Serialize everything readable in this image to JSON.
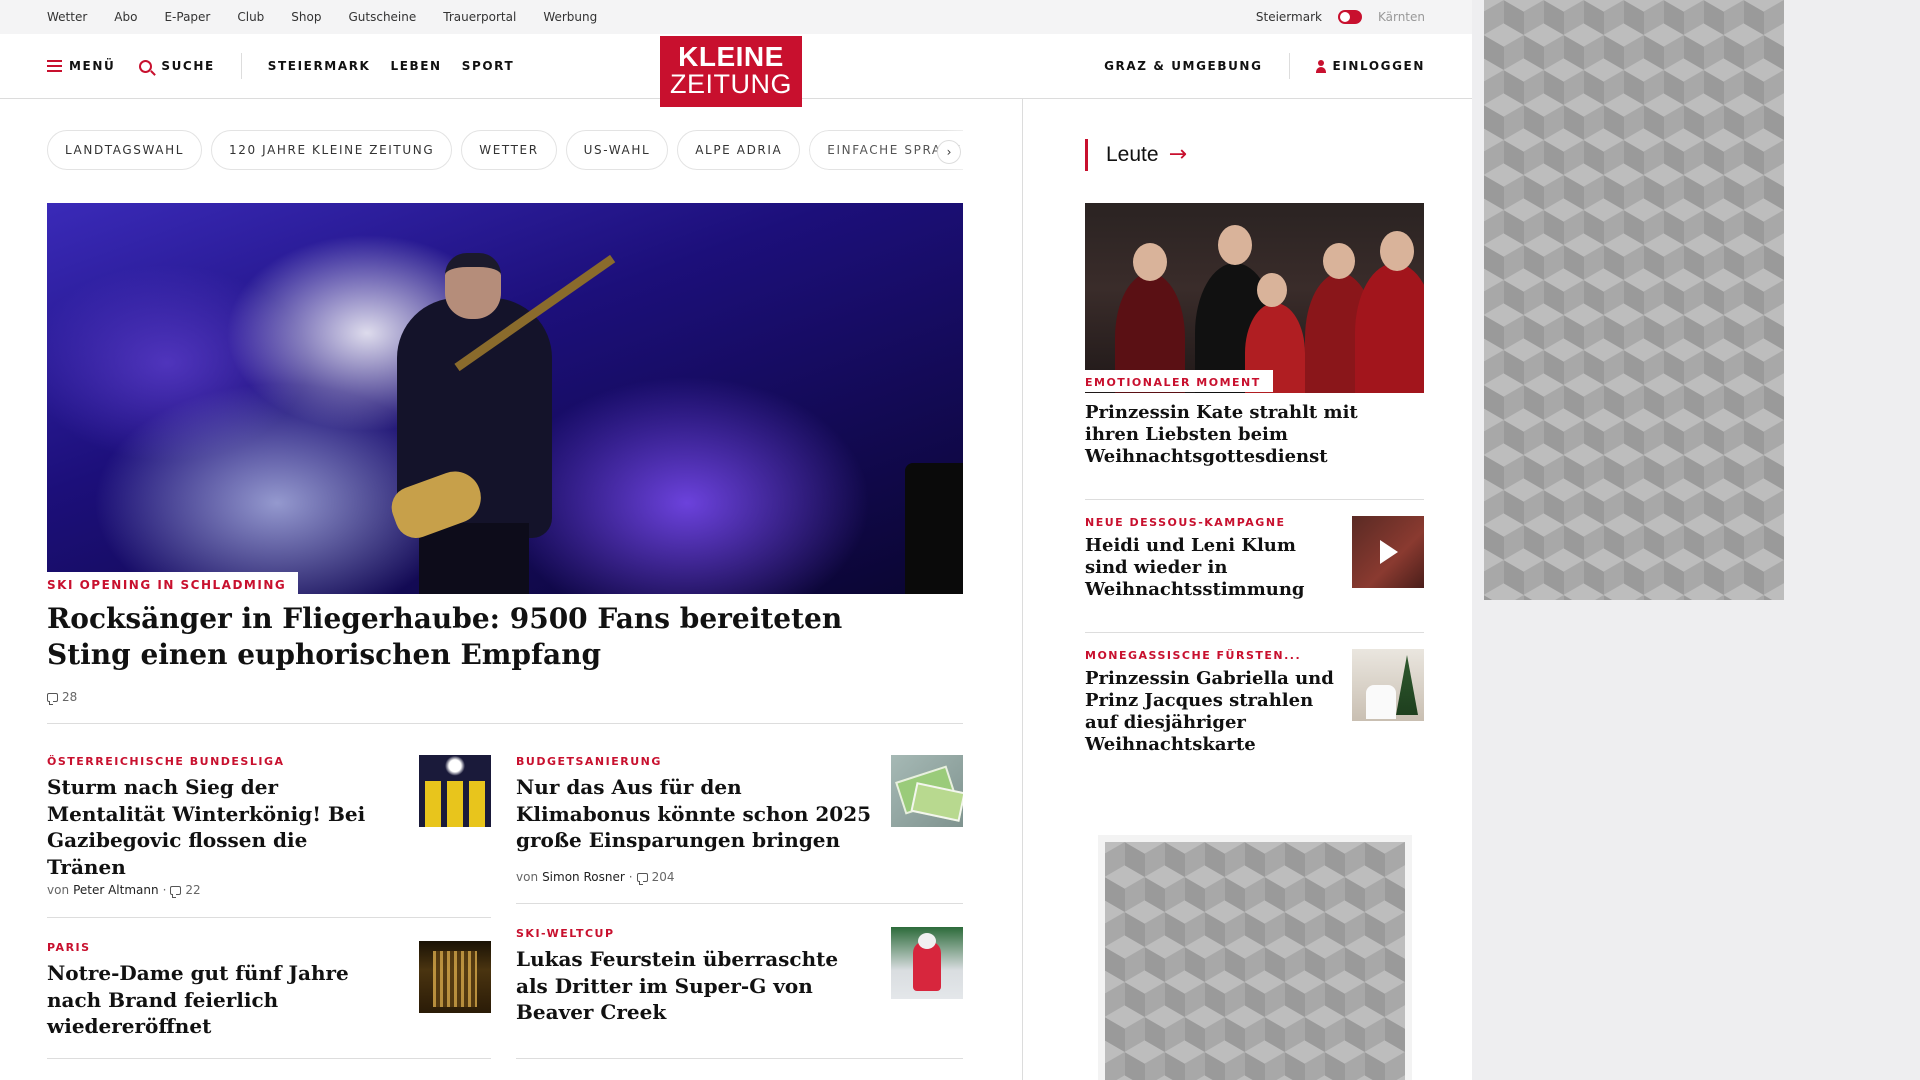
{
  "topbar": {
    "links": [
      "Wetter",
      "Abo",
      "E-Paper",
      "Club",
      "Shop",
      "Gutscheine",
      "Trauerportal",
      "Werbung"
    ],
    "region_left": "Steiermark",
    "region_right": "Kärnten"
  },
  "header": {
    "menu_label": "MENÜ",
    "search_label": "SUCHE",
    "nav": [
      "STEIERMARK",
      "LEBEN",
      "SPORT"
    ],
    "logo_line1": "KLEINE",
    "logo_line2": "ZEITUNG",
    "region_link": "GRAZ & UMGEBUNG",
    "login_label": "EINLOGGEN",
    "brand_color": "#c8102e"
  },
  "pills": [
    "LANDTAGSWAHL",
    "120 JAHRE KLEINE ZEITUNG",
    "WETTER",
    "US-WAHL",
    "ALPE ADRIA",
    "EINFACHE SPRACHE"
  ],
  "pills_next": "›",
  "hero": {
    "kicker": "SKI OPENING IN SCHLADMING",
    "title": "Rocksänger in Fliegerhaube: 9500 Fans bereiteten Sting einen euphorischen Empfang",
    "comments": "28"
  },
  "teasers": [
    {
      "kicker": "ÖSTERREICHISCHE BUNDESLIGA",
      "title": "Sturm nach Sieg der Mentalität Winterkönig! Bei Gazibegovic flossen die Tränen",
      "author_prefix": "von",
      "author": "Peter Altmann",
      "comments": "22",
      "thumb": "football-players-image"
    },
    {
      "kicker": "BUDGETSANIERUNG",
      "title": "Nur das Aus für den Klimabonus könnte schon 2025 große Einsparungen bringen",
      "author_prefix": "von",
      "author": "Simon Rosner",
      "comments": "204",
      "thumb": "money-bills-image"
    },
    {
      "kicker": "PARIS",
      "title": "Notre-Dame gut fünf Jahre nach Brand feierlich wiedereröffnet",
      "thumb": "notre-dame-image"
    },
    {
      "kicker": "SKI-WELTCUP",
      "title": "Lukas Feurstein überraschte als Dritter im Super-G von Beaver Creek",
      "thumb": "ski-racer-image"
    }
  ],
  "leute": {
    "section_label": "Leute",
    "arrow": "→",
    "lead_kicker": "EMOTIONALER MOMENT",
    "lead_title": "Prinzessin Kate strahlt mit ihren Liebsten beim Weihnachtsgottesdienst",
    "items": [
      {
        "kicker": "NEUE DESSOUS-KAMPAGNE",
        "title": "Heidi und Leni Klum sind wieder in Weihnachtsstimmung",
        "thumb": "video-thumbnail"
      },
      {
        "kicker": "MONEGASSISCHE FÜRSTEN...",
        "title": "Prinzessin Gabriella und Prinz Jacques strahlen auf diesjähriger Weihnachtskarte",
        "thumb": "christmas-card-image"
      }
    ]
  }
}
